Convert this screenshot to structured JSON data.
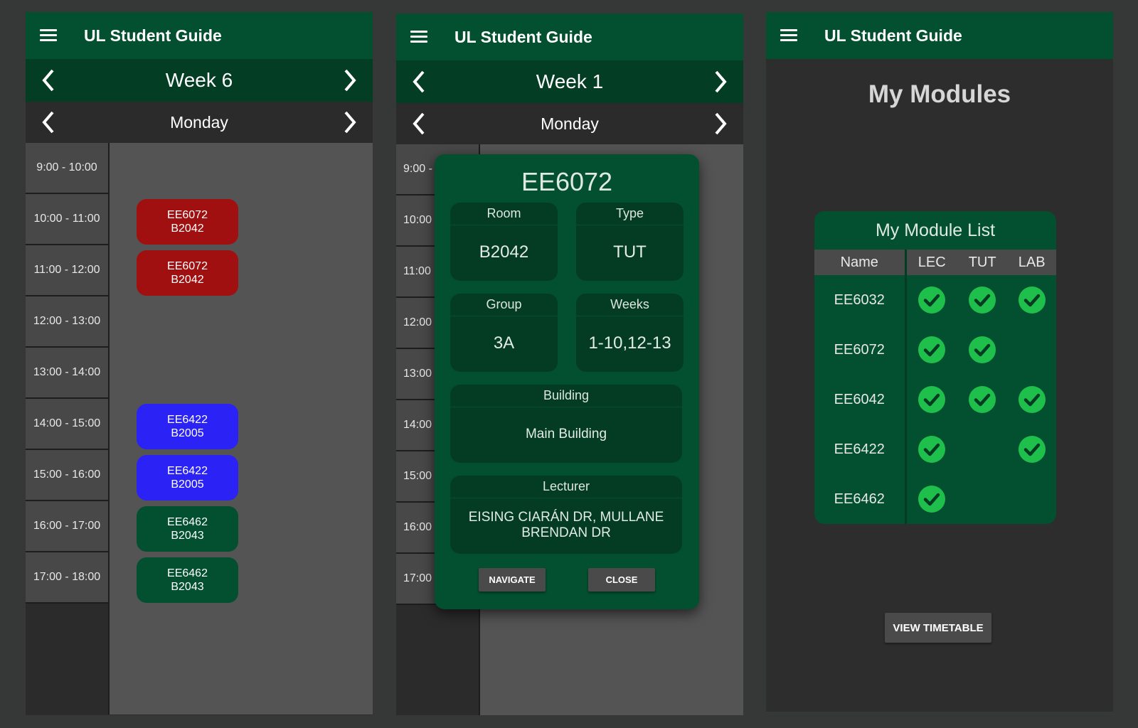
{
  "colors": {
    "app_green": "#02502f",
    "dark_green": "#023d24",
    "lecture_red": "#a01010",
    "lab_blue": "#2b23f5",
    "tutorial_green": "#02502f",
    "check_green": "#1fbf4c"
  },
  "app": {
    "title": "UL Student Guide",
    "menu_icon": "hamburger-menu-icon"
  },
  "screen1": {
    "week_label": "Week 6",
    "day_label": "Monday",
    "time_slots": [
      "9:00 - 10:00",
      "10:00 - 11:00",
      "11:00 - 12:00",
      "12:00 - 13:00",
      "13:00 - 14:00",
      "14:00 - 15:00",
      "15:00 - 16:00",
      "16:00 - 17:00",
      "17:00 - 18:00"
    ],
    "classes": [
      {
        "module": "EE6072",
        "room": "B2042",
        "slot": 1,
        "color": "#a01010"
      },
      {
        "module": "EE6072",
        "room": "B2042",
        "slot": 2,
        "color": "#a01010"
      },
      {
        "module": "EE6422",
        "room": "B2005",
        "slot": 5,
        "color": "#2b23f5"
      },
      {
        "module": "EE6422",
        "room": "B2005",
        "slot": 6,
        "color": "#2b23f5"
      },
      {
        "module": "EE6462",
        "room": "B2043",
        "slot": 7,
        "color": "#02502f"
      },
      {
        "module": "EE6462",
        "room": "B2043",
        "slot": 8,
        "color": "#02502f"
      }
    ]
  },
  "screen2": {
    "week_label": "Week 1",
    "day_label": "Monday",
    "time_slots": [
      "9:00 -",
      "10:00",
      "11:00",
      "12:00",
      "13:00",
      "14:00",
      "15:00",
      "16:00",
      "17:00"
    ],
    "dialog": {
      "title": "EE6072",
      "room_label": "Room",
      "room_value": "B2042",
      "type_label": "Type",
      "type_value": "TUT",
      "group_label": "Group",
      "group_value": "3A",
      "weeks_label": "Weeks",
      "weeks_value": "1-10,12-13",
      "building_label": "Building",
      "building_value": "Main Building",
      "lecturer_label": "Lecturer",
      "lecturer_value": "EISING CIARÁN DR, MULLANE BRENDAN DR",
      "navigate_label": "NAVIGATE",
      "close_label": "CLOSE"
    }
  },
  "screen3": {
    "heading": "My Modules",
    "list_title": "My Module List",
    "columns": [
      "Name",
      "LEC",
      "TUT",
      "LAB"
    ],
    "modules": [
      {
        "name": "EE6032",
        "lec": true,
        "tut": true,
        "lab": true
      },
      {
        "name": "EE6072",
        "lec": true,
        "tut": true,
        "lab": false
      },
      {
        "name": "EE6042",
        "lec": true,
        "tut": true,
        "lab": true
      },
      {
        "name": "EE6422",
        "lec": true,
        "tut": false,
        "lab": true
      },
      {
        "name": "EE6462",
        "lec": true,
        "tut": false,
        "lab": false
      }
    ],
    "view_button": "VIEW TIMETABLE"
  }
}
